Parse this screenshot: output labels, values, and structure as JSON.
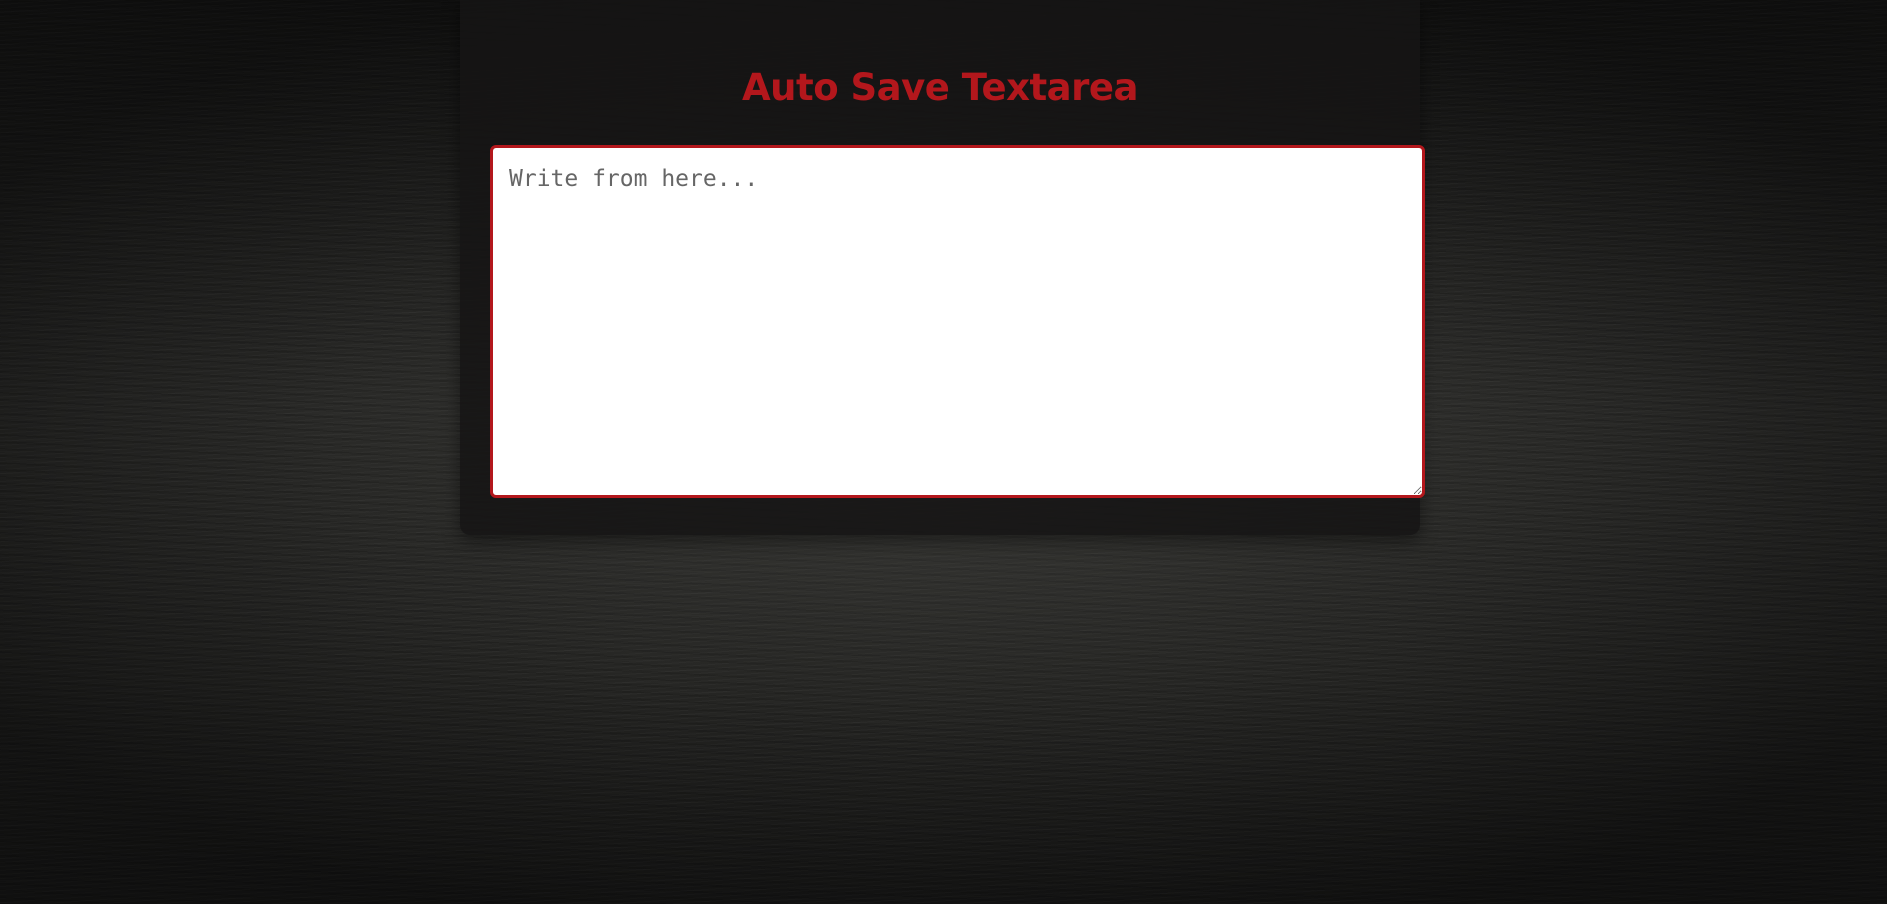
{
  "page": {
    "title": "Auto Save Textarea",
    "accent_color": "#b3171c"
  },
  "editor": {
    "value": "",
    "placeholder": "Write from here..."
  }
}
